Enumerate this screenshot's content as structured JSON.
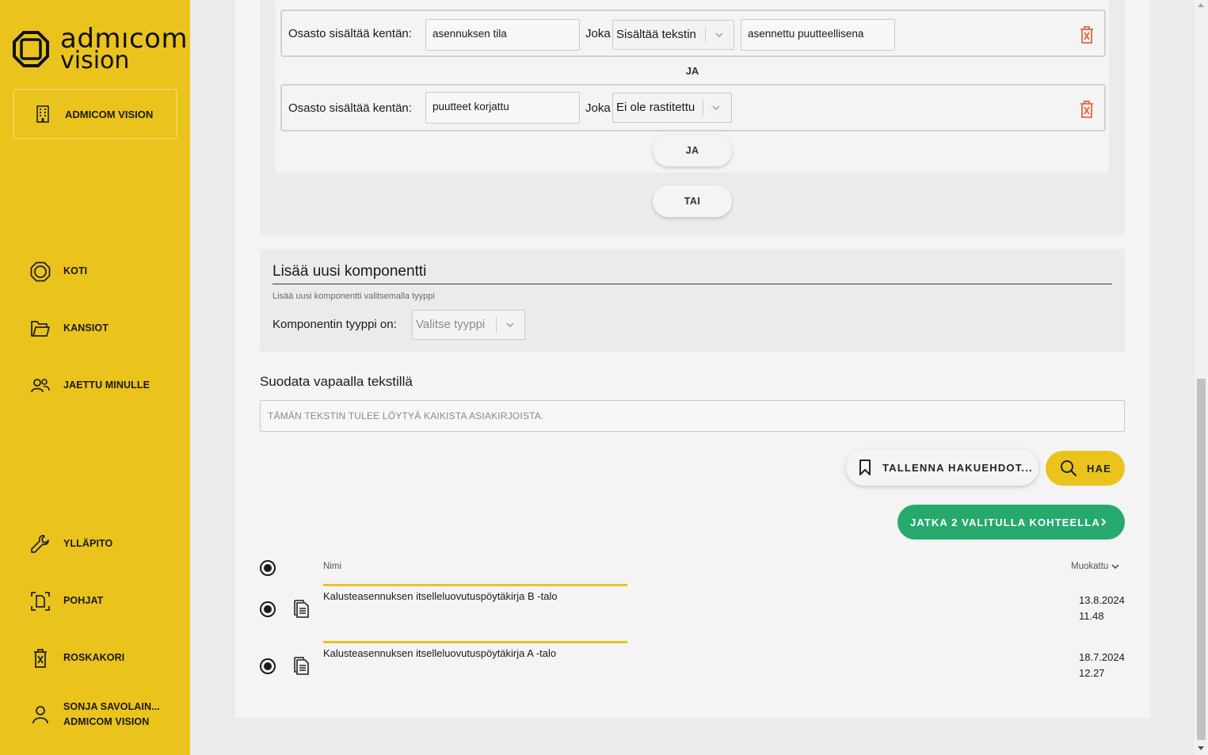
{
  "sidebar": {
    "logo": {
      "line1": "admıcom",
      "line2": "vision"
    },
    "org_button": "ADMICOM VISION",
    "nav": [
      {
        "label": "KOTI",
        "icon": "home-icon"
      },
      {
        "label": "KANSIOT",
        "icon": "folder-icon"
      },
      {
        "label": "JAETTU MINULLE",
        "icon": "users-icon"
      },
      {
        "label": "YLLÄPITO",
        "icon": "wrench-icon"
      },
      {
        "label": "POHJAT",
        "icon": "template-icon"
      },
      {
        "label": "ROSKAKORI",
        "icon": "trash-icon"
      }
    ],
    "user": {
      "name": "SONJA SAVOLAIN...",
      "org": "ADMICOM VISION"
    },
    "colors": {
      "brand": "#eac31d"
    }
  },
  "filters": {
    "conditions": [
      {
        "label": "Osasto sisältää kentän:",
        "field": "asennuksen tila",
        "joka": "Joka",
        "operator": "Sisältää tekstin",
        "value": "asennettu puutteellisena"
      },
      {
        "label": "Osasto sisältää kentän:",
        "field": "puutteet korjattu",
        "joka": "Joka",
        "operator": "Ei ole rastitettu"
      }
    ],
    "and_separator": "JA",
    "and_button": "JA",
    "or_button": "TAI"
  },
  "add_component": {
    "title": "Lisää uusi komponentti",
    "hint": "Lisää uusi komponentti valitsemalla tyyppi",
    "type_label": "Komponentin tyyppi on:",
    "type_placeholder": "Valitse tyyppi"
  },
  "free_text": {
    "title": "Suodata vapaalla tekstillä",
    "placeholder": "TÄMÄN TEKSTIN TULEE LÖYTYÄ KAIKISTA ASIAKIRJOISTA."
  },
  "actions": {
    "save": "TALLENNA HAKUEHDOT...",
    "search": "HAE",
    "continue": "JATKA 2 VALITULLA KOHTEELLA",
    "accent_green": "#27a96e"
  },
  "results": {
    "columns": {
      "name": "Nimi",
      "modified": "Muokattu"
    },
    "rows": [
      {
        "name": "Kalusteasennuksen itselleluovutuspöytäkirja B -talo",
        "date": "13.8.2024",
        "time": "11.48"
      },
      {
        "name": "Kalusteasennuksen itselleluovutuspöytäkirja A -talo",
        "date": "18.7.2024",
        "time": "12.27"
      }
    ]
  }
}
